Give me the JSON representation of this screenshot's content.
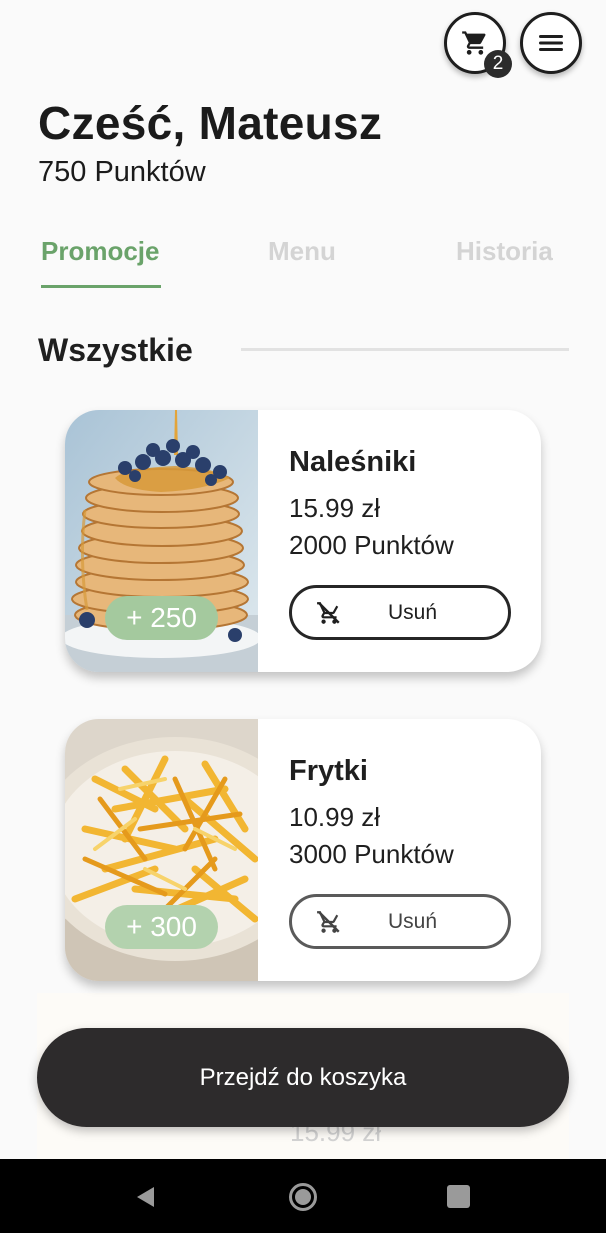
{
  "header": {
    "greeting": "Cześć, Mateusz",
    "points": "750 Punktów",
    "cart_count": "2",
    "cart_icon": "cart-icon",
    "menu_icon": "hamburger-menu-icon"
  },
  "tabs": [
    {
      "label": "Promocje",
      "active": true
    },
    {
      "label": "Menu",
      "active": false
    },
    {
      "label": "Historia",
      "active": false
    }
  ],
  "section": {
    "title": "Wszystkie"
  },
  "items": [
    {
      "name": "Naleśniki",
      "price": "15.99 zł",
      "points": "2000 Punktów",
      "bonus": "+ 250",
      "button_label": "Usuń",
      "button_icon": "remove-from-cart-icon",
      "image": "pancakes-image"
    },
    {
      "name": "Frytki",
      "price": "10.99 zł",
      "points": "3000 Punktów",
      "bonus": "+ 300",
      "button_label": "Usuń",
      "button_icon": "remove-from-cart-icon",
      "image": "fries-image"
    }
  ],
  "partial_item": {
    "price": "15.99 zł"
  },
  "go_to_cart_label": "Przejdź do koszyka",
  "colors": {
    "accent": "#6aa36a",
    "bonus": "#a4c99e",
    "dark": "#2d2b2c",
    "inactive_tab": "#d4d4d4"
  }
}
